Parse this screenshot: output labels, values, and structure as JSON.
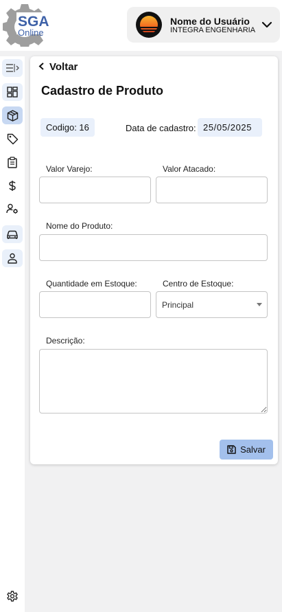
{
  "header": {
    "logo_title": "SGA",
    "logo_subtitle": "Online",
    "user_name": "Nome do Usuário",
    "user_company": "INTEGRA ENGENHARIA"
  },
  "sidebar": {
    "items": [
      {
        "icon": "collapse-sidebar-icon"
      },
      {
        "icon": "dashboard-icon"
      },
      {
        "icon": "box-icon",
        "active": true
      },
      {
        "icon": "tag-icon"
      },
      {
        "icon": "clipboard-icon"
      },
      {
        "icon": "dollar-icon"
      },
      {
        "icon": "user-settings-icon"
      },
      {
        "icon": "car-icon"
      },
      {
        "icon": "person-icon"
      },
      {
        "icon": "settings-icon"
      }
    ]
  },
  "form": {
    "back_label": "Voltar",
    "title": "Cadastro de Produto",
    "code_text": "Codigo: 16",
    "date_label": "Data de cadastro:",
    "date_value": "25/05/2025",
    "fields": {
      "retail_label": "Valor Varejo:",
      "retail_value": "",
      "wholesale_label": "Valor Atacado:",
      "wholesale_value": "",
      "name_label": "Nome do Produto:",
      "name_value": "",
      "qty_label": "Quantidade em Estoque:",
      "qty_value": "",
      "center_label": "Centro de Estoque:",
      "center_value": "Principal",
      "desc_label": "Descrição:",
      "desc_value": ""
    },
    "save_label": "Salvar"
  },
  "colors": {
    "brand": "#3f62a8",
    "save_button": "#a3c0ec",
    "chip_bg": "#e9f0fb",
    "active_sidebar": "#c7d8f2"
  }
}
